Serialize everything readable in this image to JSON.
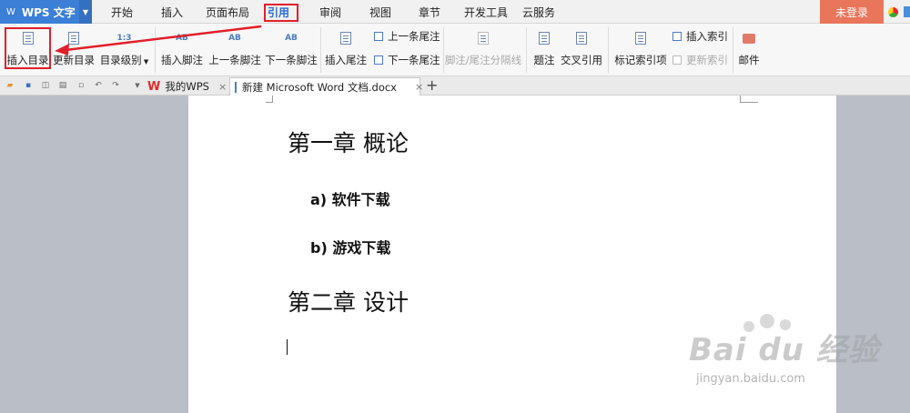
{
  "app": {
    "name": "WPS 文字",
    "logo": "W"
  },
  "menu": {
    "tabs": [
      "开始",
      "插入",
      "页面布局",
      "引用",
      "审阅",
      "视图",
      "章节",
      "开发工具",
      "云服务"
    ],
    "active": "引用",
    "login": "未登录"
  },
  "ribbon": {
    "insert_toc": "插入目录",
    "update_toc": "更新目录",
    "toc_level": "目录级别",
    "insert_footnote": "插入脚注",
    "prev_footnote": "上一条脚注",
    "next_footnote": "下一条脚注",
    "footnote_icon_text": "AB",
    "insert_endnote": "插入尾注",
    "prev_endnote": "上一条尾注",
    "next_endnote": "下一条尾注",
    "separator_line": "脚注/尾注分隔线",
    "caption": "题注",
    "cross_ref": "交叉引用",
    "mark_index": "标记索引项",
    "insert_index": "插入索引",
    "update_index": "更新索引",
    "mail": "邮件"
  },
  "tabs": {
    "my_wps": "我的WPS",
    "doc": "新建 Microsoft Word 文档.docx",
    "close": "×",
    "add": "+"
  },
  "document": {
    "chapter1": "第一章  概论",
    "item_a": "a)  软件下载",
    "item_b": "b)  游戏下载",
    "chapter2": "第二章  设计"
  },
  "watermark": {
    "brand": "Bai du 经验",
    "url": "jingyan.baidu.com"
  },
  "colors": {
    "app_blue": "#3b7fd6",
    "login_orange": "#e9755a",
    "highlight_red": "#e0202a"
  }
}
